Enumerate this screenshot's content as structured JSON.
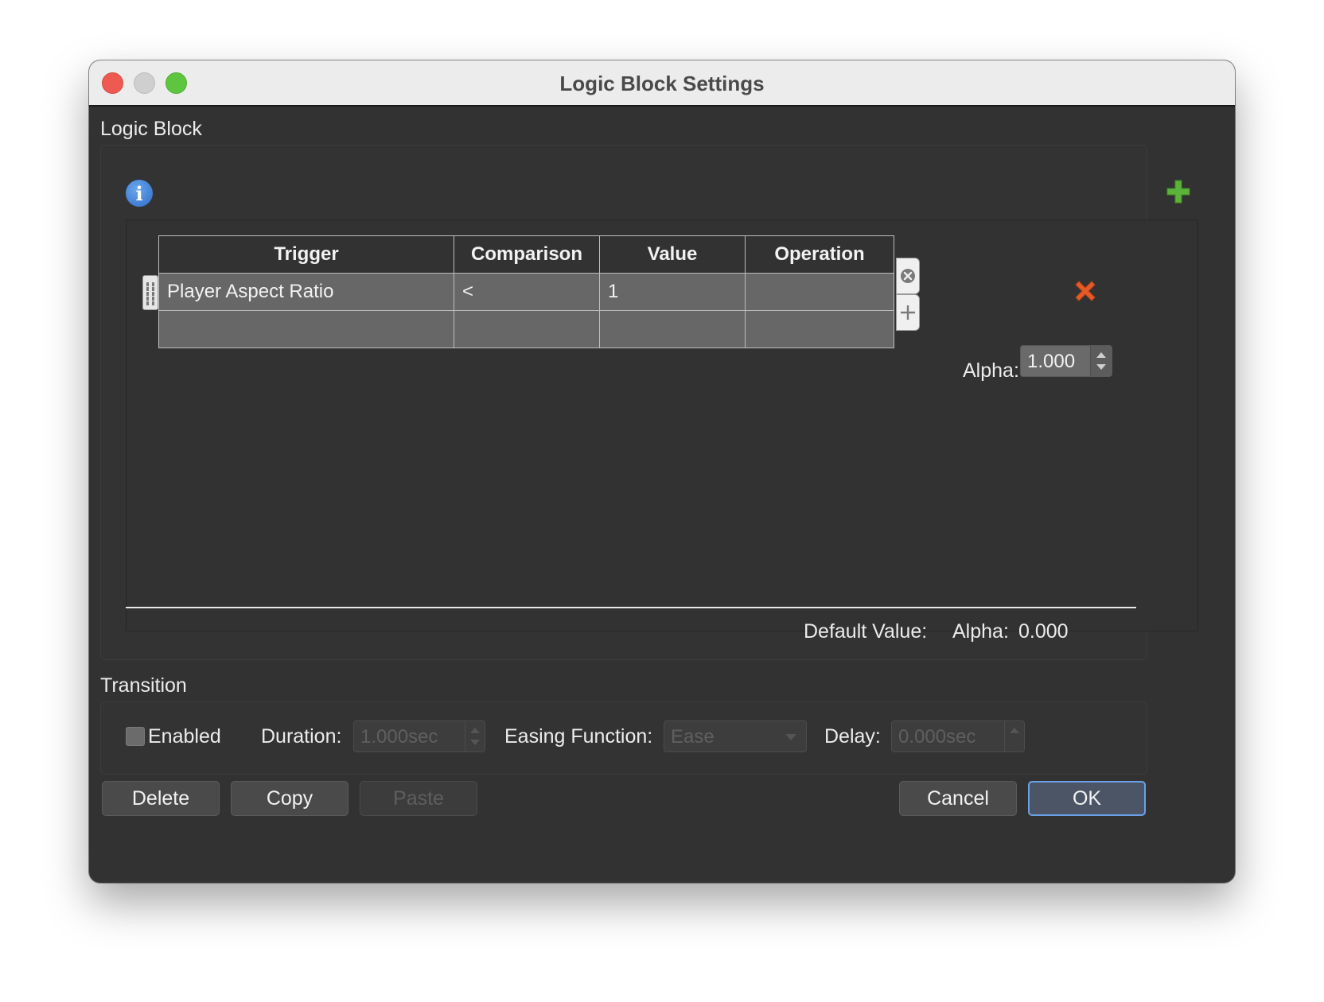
{
  "window": {
    "title": "Logic Block Settings"
  },
  "logic_block": {
    "section_label": "Logic Block",
    "table": {
      "headers": [
        "Trigger",
        "Comparison",
        "Value",
        "Operation"
      ],
      "rows": [
        [
          "Player Aspect Ratio",
          "<",
          "1",
          ""
        ],
        [
          "",
          "",
          "",
          ""
        ]
      ]
    },
    "alpha_label": "Alpha:",
    "alpha_value": "1.000",
    "default_value_label": "Default Value:",
    "default_alpha_label": "Alpha:",
    "default_alpha_value": "0.000"
  },
  "transition": {
    "section_label": "Transition",
    "enabled_label": "Enabled",
    "enabled_checked": false,
    "duration_label": "Duration:",
    "duration_value": "1.000sec",
    "easing_label": "Easing Function:",
    "easing_value": "Ease",
    "delay_label": "Delay:",
    "delay_value": "0.000sec"
  },
  "buttons": {
    "delete": "Delete",
    "copy": "Copy",
    "paste": "Paste",
    "cancel": "Cancel",
    "ok": "OK"
  },
  "colors": {
    "add_icon": "#5bb33a",
    "remove_icon": "#e55b26",
    "info_icon": "#3b7bd6",
    "ok_border": "#6aa0e6"
  },
  "icons": {
    "info": "info-icon",
    "add_rule": "plus-icon",
    "remove_rule": "x-icon",
    "remove_row": "circle-x-icon",
    "add_row": "plus-icon",
    "drag": "drag-handle-icon"
  }
}
